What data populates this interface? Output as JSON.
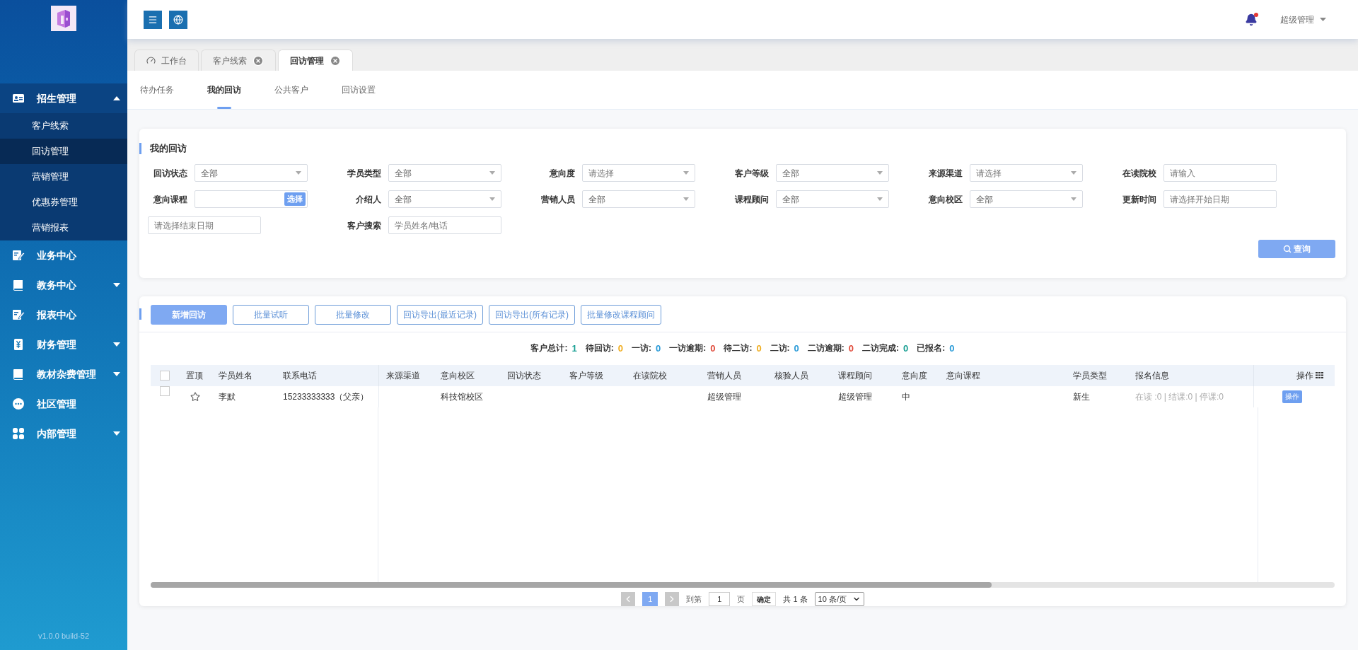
{
  "sidebar": {
    "version": "v1.0.0 build-52",
    "items": [
      {
        "label": "招生管理",
        "kind": "idcard",
        "expandable": true,
        "expanded": true,
        "children": [
          {
            "label": "客户线索",
            "selected": false
          },
          {
            "label": "回访管理",
            "selected": true
          },
          {
            "label": "营销管理",
            "selected": false
          },
          {
            "label": "优惠券管理",
            "selected": false
          },
          {
            "label": "营销报表",
            "selected": false
          }
        ]
      },
      {
        "label": "业务中心",
        "kind": "edit",
        "expandable": false
      },
      {
        "label": "教务中心",
        "kind": "book",
        "expandable": true,
        "expanded": false
      },
      {
        "label": "报表中心",
        "kind": "edit",
        "expandable": false
      },
      {
        "label": "财务管理",
        "kind": "money",
        "expandable": true,
        "expanded": false
      },
      {
        "label": "教材杂费管理",
        "kind": "book",
        "expandable": true,
        "expanded": false
      },
      {
        "label": "社区管理",
        "kind": "dots",
        "expandable": false
      },
      {
        "label": "内部管理",
        "kind": "grid",
        "expandable": true,
        "expanded": false
      }
    ]
  },
  "header": {
    "user": "超级管理",
    "notification": true
  },
  "page_tabs": [
    {
      "label": "工作台",
      "icon": true,
      "closable": false,
      "selected": false
    },
    {
      "label": "客户线索",
      "icon": false,
      "closable": true,
      "selected": false
    },
    {
      "label": "回访管理",
      "icon": false,
      "closable": true,
      "selected": true
    }
  ],
  "sub_tabs": [
    {
      "label": "待办任务",
      "selected": false
    },
    {
      "label": "我的回访",
      "selected": true
    },
    {
      "label": "公共客户",
      "selected": false
    },
    {
      "label": "回访设置",
      "selected": false
    }
  ],
  "filter": {
    "title": "我的回访",
    "query_button": "查询",
    "fields": [
      {
        "label": "回访状态",
        "kind": "select",
        "value": "全部"
      },
      {
        "label": "学员类型",
        "kind": "select",
        "value": "全部"
      },
      {
        "label": "意向度",
        "kind": "select",
        "placeholder": "请选择"
      },
      {
        "label": "客户等级",
        "kind": "select",
        "value": "全部"
      },
      {
        "label": "来源渠道",
        "kind": "select",
        "placeholder": "请选择"
      },
      {
        "label": "在读院校",
        "kind": "input",
        "placeholder": "请输入"
      },
      {
        "label": "意向课程",
        "kind": "picker",
        "button": "选择"
      },
      {
        "label": "介绍人",
        "kind": "select",
        "value": "全部"
      },
      {
        "label": "营销人员",
        "kind": "select",
        "value": "全部"
      },
      {
        "label": "课程顾问",
        "kind": "select",
        "value": "全部"
      },
      {
        "label": "意向校区",
        "kind": "select",
        "value": "全部"
      },
      {
        "label": "更新时间",
        "kind": "input",
        "placeholder": "请选择开始日期"
      },
      {
        "kind": "input",
        "placeholder": "请选择结束日期"
      },
      {
        "label": "客户搜索",
        "kind": "input",
        "placeholder": "学员姓名/电话"
      }
    ]
  },
  "toolbar": [
    {
      "label": "新增回访",
      "primary": true
    },
    {
      "label": "批量试听",
      "primary": false
    },
    {
      "label": "批量修改",
      "primary": false
    },
    {
      "label": "回访导出(最近记录)",
      "primary": false
    },
    {
      "label": "回访导出(所有记录)",
      "primary": false
    },
    {
      "label": "批量修改课程顾问",
      "primary": false
    }
  ],
  "stats": [
    {
      "label": "客户总计:",
      "value": "1",
      "color": "#1aa094"
    },
    {
      "label": "待回访:",
      "value": "0",
      "color": "#f0ad1e"
    },
    {
      "label": "一访:",
      "value": "0",
      "color": "#2a9bd8"
    },
    {
      "label": "一访逾期:",
      "value": "0",
      "color": "#e04a3a"
    },
    {
      "label": "待二访:",
      "value": "0",
      "color": "#f0ad1e"
    },
    {
      "label": "二访:",
      "value": "0",
      "color": "#2a9bd8"
    },
    {
      "label": "二访逾期:",
      "value": "0",
      "color": "#e04a3a"
    },
    {
      "label": "二访完成:",
      "value": "0",
      "color": "#1aa094"
    },
    {
      "label": "已报名:",
      "value": "0",
      "color": "#2a9bd8"
    }
  ],
  "table": {
    "select_all_checked": false,
    "columns": [
      "置顶",
      "学员姓名",
      "联系电话",
      "来源渠道",
      "意向校区",
      "回访状态",
      "客户等级",
      "在读院校",
      "营销人员",
      "核验人员",
      "课程顾问",
      "意向度",
      "意向课程",
      "学员类型",
      "报名信息",
      "操作"
    ],
    "rows": [
      {
        "checked": false,
        "pinned": false,
        "cells": {
          "1": "李默",
          "2": "15233333333（父亲）",
          "4": "科技馆校区",
          "8": "超级管理",
          "10": "超级管理",
          "11": "中",
          "13": "新生",
          "14": "在读 :0 | 结课:0 | 停课:0"
        },
        "action": "操作"
      }
    ]
  },
  "pagination": {
    "pages": [
      {
        "label": "1",
        "selected": true
      }
    ],
    "goto_label": "到第",
    "goto_value": "1",
    "page_unit": "页",
    "confirm": "确定",
    "total": "共 1 条",
    "page_size": "10 条/页"
  }
}
